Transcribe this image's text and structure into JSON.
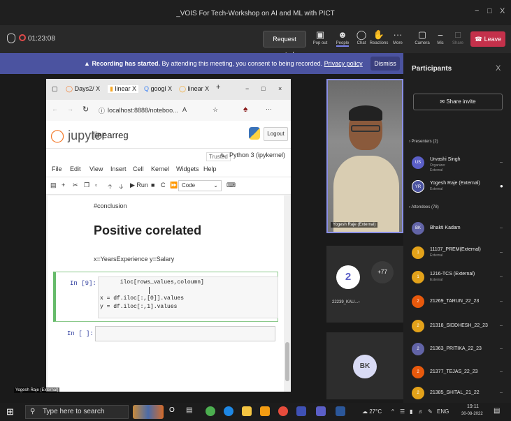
{
  "window": {
    "title": "_VOIS For Tech-Workshop on AI and ML with PICT",
    "controls": [
      "−",
      "□",
      "X"
    ]
  },
  "meeting_bar": {
    "timer": "01:23:08",
    "request_control": "Request control",
    "buttons": [
      {
        "label": "Pop out",
        "icon": "pop-out-icon"
      },
      {
        "label": "People",
        "icon": "people-icon"
      },
      {
        "label": "Chat",
        "icon": "chat-icon"
      },
      {
        "label": "Reactions",
        "icon": "reactions-icon"
      },
      {
        "label": "More",
        "icon": "more-icon"
      },
      {
        "label": "Camera",
        "icon": "camera-icon"
      },
      {
        "label": "Mic",
        "icon": "mic-icon"
      },
      {
        "label": "Share",
        "icon": "share-icon"
      }
    ],
    "leave": "Leave"
  },
  "banner": {
    "bold": "Recording has started.",
    "text": "By attending this meeting, you consent to being recorded.",
    "link": "Privacy policy",
    "dismiss": "Dismiss"
  },
  "browser": {
    "tabs": [
      "Days2/",
      "linear",
      "googl",
      "linear"
    ],
    "tab_close": "X",
    "new_tab": "+",
    "url": "localhost:8888/noteboo..."
  },
  "jupyter": {
    "logo": "jupyter",
    "notebook_name": "linearreg",
    "logout": "Logout",
    "trusted": "Trusted",
    "kernel": "Python 3 (ipykernel)",
    "menu": [
      "File",
      "Edit",
      "View",
      "Insert",
      "Cell",
      "Kernel",
      "Widgets",
      "Help"
    ],
    "run": "Run",
    "cell_type": "Code",
    "cells": {
      "md1": "#conclusion",
      "heading": "Positive corelated",
      "md2": "x=YearsExperience y=Salary",
      "code_prompt": "In [9]:",
      "code_lines": [
        "      iloc[rows_values,coloumn]",
        "",
        "x = df.iloc[:,[0]].values",
        "y = df.iloc[:,1].values"
      ],
      "empty_prompt": "In [ ]:"
    }
  },
  "video": {
    "presenter_name": "Yogesh Raje (External)",
    "tile_count": "2",
    "tile_plus": "+77",
    "tile_label": "22239_KAU...",
    "bk": "BK",
    "bottom_tag": "Yogesh Raje (External)"
  },
  "participants": {
    "title": "Participants",
    "close": "X",
    "share_invite": "Share invite",
    "presenters_header": "Presenters (2)",
    "presenters": [
      {
        "initials": "US",
        "name": "Urvashi Singh",
        "sub1": "Organizer",
        "sub2": "External",
        "color": "#5b5fc7"
      },
      {
        "initials": "YR",
        "name": "Yogesh Raje (External)",
        "sub1": "External",
        "sub2": "",
        "color": "#4b53a0"
      }
    ],
    "attendees_header": "Attendees (78)",
    "attendees": [
      {
        "initials": "BK",
        "name": "Bhakti Kadam",
        "sub": "",
        "color": "#6264a7"
      },
      {
        "initials": "1",
        "name": "11107_PREM(External)",
        "sub": "External",
        "color": "#e3a21a"
      },
      {
        "initials": "1",
        "name": "1216-TCS (External)",
        "sub": "External",
        "color": "#e3a21a"
      },
      {
        "initials": "2",
        "name": "21269_TARUN_22_23",
        "sub": "",
        "color": "#e8590c"
      },
      {
        "initials": "2",
        "name": "21318_SIDDHESH_22_23",
        "sub": "",
        "color": "#e3a21a"
      },
      {
        "initials": "2",
        "name": "21363_PRITIKA_22_23",
        "sub": "",
        "color": "#6264a7"
      },
      {
        "initials": "2",
        "name": "21377_TEJAS_22_23",
        "sub": "",
        "color": "#e8590c"
      },
      {
        "initials": "2",
        "name": "21385_SHITAL_21_22",
        "sub": "",
        "color": "#e3a21a"
      }
    ]
  },
  "taskbar": {
    "search_placeholder": "Type here to search",
    "weather": "27°C",
    "lang": "ENG",
    "time": "19:11",
    "date": "30-08-2022"
  }
}
